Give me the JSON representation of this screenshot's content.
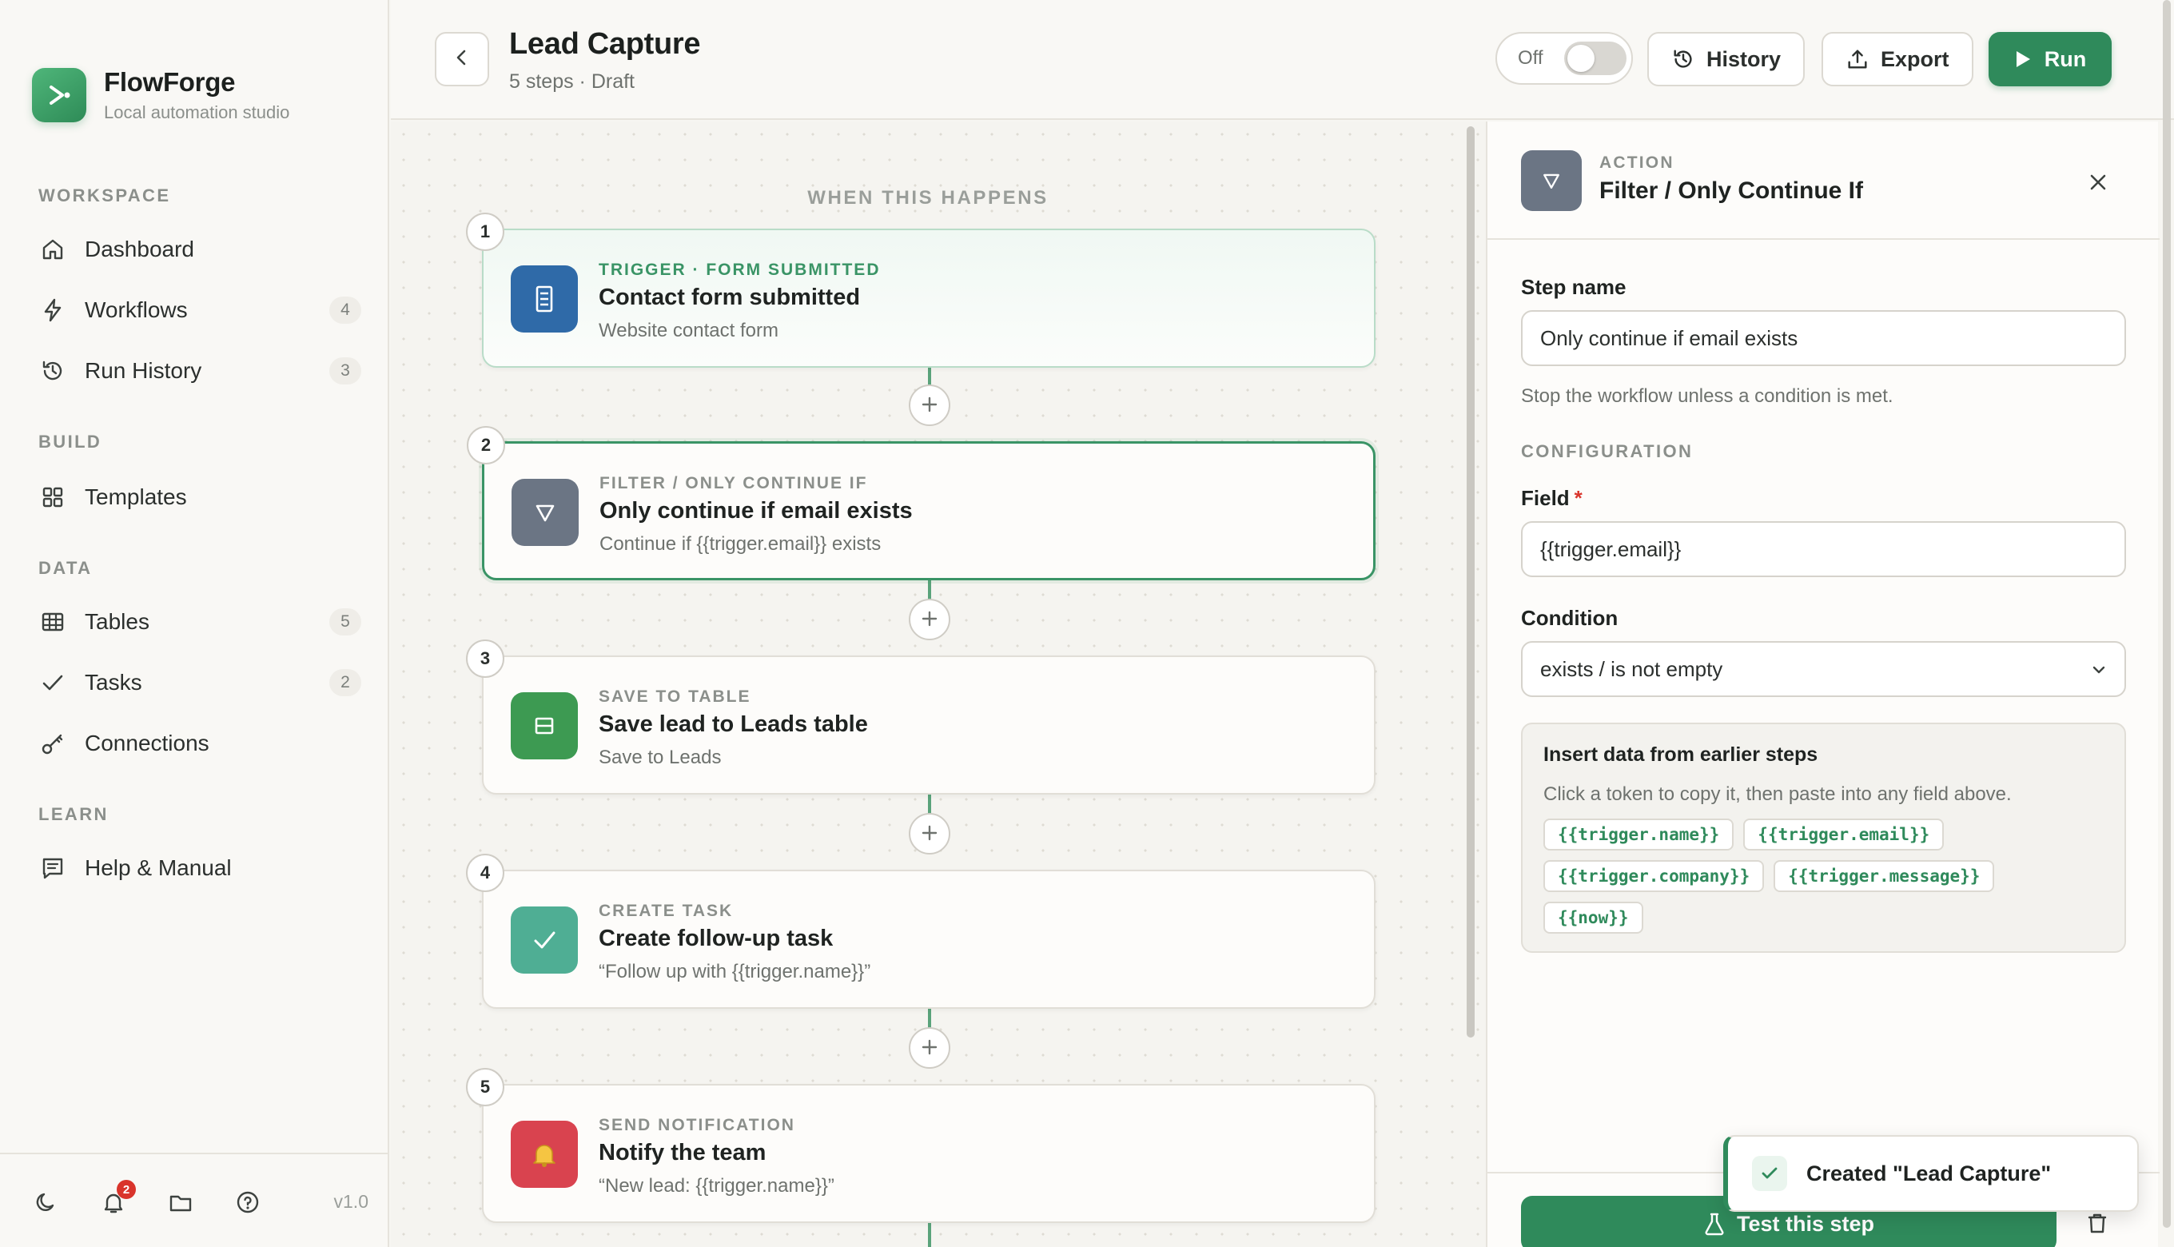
{
  "brand": {
    "name": "FlowForge",
    "subtitle": "Local automation studio"
  },
  "sidebar": {
    "sections": [
      {
        "label": "WORKSPACE"
      },
      {
        "label": "BUILD"
      },
      {
        "label": "DATA"
      },
      {
        "label": "LEARN"
      }
    ],
    "items": [
      {
        "label": "Dashboard",
        "icon": "home-icon",
        "count": ""
      },
      {
        "label": "Workflows",
        "icon": "lightning-icon",
        "count": "4"
      },
      {
        "label": "Run History",
        "icon": "history-icon",
        "count": "3"
      },
      {
        "label": "Templates",
        "icon": "grid-icon",
        "count": ""
      },
      {
        "label": "Tables",
        "icon": "table-icon",
        "count": "5"
      },
      {
        "label": "Tasks",
        "icon": "check-icon",
        "count": "2"
      },
      {
        "label": "Connections",
        "icon": "key-icon",
        "count": ""
      },
      {
        "label": "Help & Manual",
        "icon": "manual-icon",
        "count": ""
      }
    ],
    "footer": {
      "notification_count": "2",
      "version": "v1.0"
    }
  },
  "header": {
    "title": "Lead Capture",
    "subtitle": "5 steps · Draft",
    "toggle_label": "Off",
    "toggle_on": false,
    "history_label": "History",
    "export_label": "Export",
    "run_label": "Run"
  },
  "canvas": {
    "section_label": "WHEN THIS HAPPENS",
    "steps": [
      {
        "number": "1",
        "type": "TRIGGER · FORM SUBMITTED",
        "title": "Contact form submitted",
        "description": "Website contact form",
        "icon": "form-icon",
        "color": "#2f6aa8"
      },
      {
        "number": "2",
        "type": "FILTER / ONLY CONTINUE IF",
        "title": "Only continue if email exists",
        "description": "Continue if {{trigger.email}} exists",
        "icon": "filter-icon",
        "color": "#6b7584"
      },
      {
        "number": "3",
        "type": "SAVE TO TABLE",
        "title": "Save lead to Leads table",
        "description": "Save to Leads",
        "icon": "table-save-icon",
        "color": "#3d9a52"
      },
      {
        "number": "4",
        "type": "CREATE TASK",
        "title": "Create follow-up task",
        "description": "“Follow up with {{trigger.name}}”",
        "icon": "check-icon",
        "color": "#4fae94"
      },
      {
        "number": "5",
        "type": "SEND NOTIFICATION",
        "title": "Notify the team",
        "description": "“New lead: {{trigger.name}}”",
        "icon": "bell-icon",
        "color": "#d9434f"
      }
    ]
  },
  "panel": {
    "kicker": "ACTION",
    "title": "Filter / Only Continue If",
    "step_name_label": "Step name",
    "step_name_value": "Only continue if email exists",
    "step_help": "Stop the workflow unless a condition is met.",
    "config_label": "CONFIGURATION",
    "field_label": "Field",
    "field_required": "*",
    "field_value": "{{trigger.email}}",
    "condition_label": "Condition",
    "condition_value": "exists / is not empty",
    "tokens_title": "Insert data from earlier steps",
    "tokens_help": "Click a token to copy it, then paste into any field above.",
    "tokens": [
      "{{trigger.name}}",
      "{{trigger.email}}",
      "{{trigger.company}}",
      "{{trigger.message}}",
      "{{now}}"
    ],
    "test_label": "Test this step"
  },
  "toast": {
    "message": "Created \"Lead Capture\""
  },
  "colors": {
    "accent": "#2f8a5b",
    "danger": "#d9342b"
  }
}
